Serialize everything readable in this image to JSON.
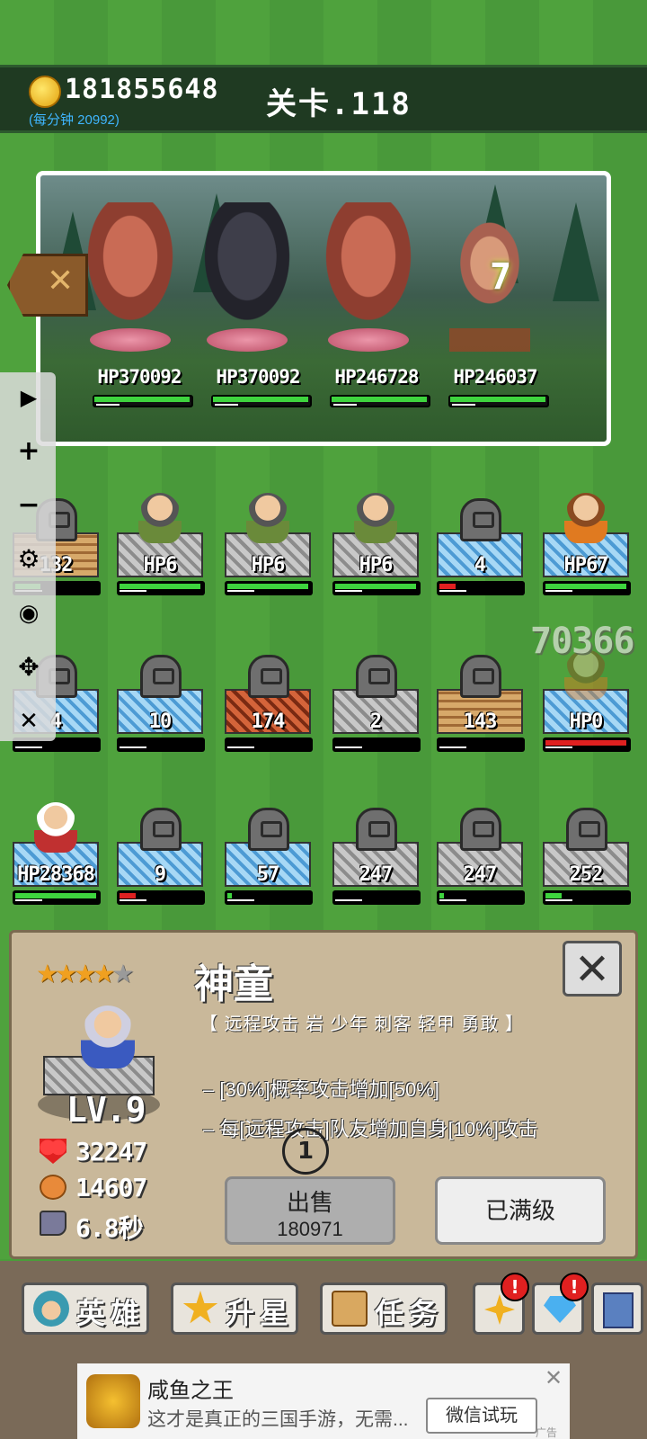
{
  "header": {
    "gold": "181855648",
    "per_minute": "(每分钟 20992)",
    "stage": "关卡.118"
  },
  "battle": {
    "damage_popup": "7",
    "enemies": [
      {
        "type": "ogre",
        "hp": "HP370092",
        "hp_fraction": 0.98
      },
      {
        "type": "dark-knight",
        "hp": "HP370092",
        "hp_fraction": 0.98
      },
      {
        "type": "ogre",
        "hp": "HP246728",
        "hp_fraction": 0.98
      },
      {
        "type": "monk",
        "hp": "HP246037",
        "hp_fraction": 0.98
      }
    ]
  },
  "sidebar": {
    "play": "▶",
    "zoom_in": "+",
    "zoom_out": "−",
    "settings": "⚙",
    "hide": "◉",
    "move": "✥",
    "close": "✕"
  },
  "grid": {
    "floating_number": "70366",
    "cells": [
      {
        "block": "wood",
        "unit": "tomb",
        "label": "132",
        "hp_fraction": 0.3,
        "red": false
      },
      {
        "block": "stone",
        "unit": "boy",
        "label": "HP6",
        "hp_fraction": 0.98,
        "red": false
      },
      {
        "block": "stone",
        "unit": "boy",
        "label": "HP6",
        "hp_fraction": 0.98,
        "red": false
      },
      {
        "block": "stone",
        "unit": "boy",
        "label": "HP6",
        "hp_fraction": 0.98,
        "red": false
      },
      {
        "block": "ice",
        "unit": "tomb",
        "label": "4",
        "hp_fraction": 0.2,
        "red": true
      },
      {
        "block": "ice",
        "unit": "girl",
        "label": "HP67",
        "hp_fraction": 0.98,
        "red": false
      },
      {
        "block": "ice",
        "unit": "tomb",
        "label": "4",
        "hp_fraction": 0,
        "red": false
      },
      {
        "block": "ice",
        "unit": "tomb",
        "label": "10",
        "hp_fraction": 0,
        "red": false
      },
      {
        "block": "lava",
        "unit": "tomb",
        "label": "174",
        "hp_fraction": 0,
        "red": false
      },
      {
        "block": "stone",
        "unit": "tomb",
        "label": "2",
        "hp_fraction": 0,
        "red": false
      },
      {
        "block": "wood",
        "unit": "tomb",
        "label": "143",
        "hp_fraction": 0,
        "red": false
      },
      {
        "block": "ice",
        "unit": "ghost",
        "label": "HP0",
        "hp_fraction": 0.98,
        "red": true
      },
      {
        "block": "ice",
        "unit": "sage",
        "label": "HP28368",
        "hp_fraction": 0.98,
        "red": false
      },
      {
        "block": "ice",
        "unit": "tomb",
        "label": "9",
        "hp_fraction": 0.2,
        "red": true
      },
      {
        "block": "ice",
        "unit": "tomb",
        "label": "57",
        "hp_fraction": 0.05,
        "red": false
      },
      {
        "block": "stone",
        "unit": "tomb",
        "label": "247",
        "hp_fraction": 0,
        "red": false
      },
      {
        "block": "stone",
        "unit": "tomb",
        "label": "247",
        "hp_fraction": 0.05,
        "red": false
      },
      {
        "block": "stone",
        "unit": "tomb",
        "label": "252",
        "hp_fraction": 0.2,
        "red": false
      }
    ]
  },
  "detail": {
    "stars_filled": "★★★★",
    "stars_empty": "★",
    "name": "神童",
    "tags": "【 远程攻击  岩  少年  刺客  轻甲  勇敢 】",
    "close": "✕",
    "level": "LV.9",
    "hp": "32247",
    "attack": "14607",
    "speed": "6.8秒",
    "skills": [
      "– [30%]概率攻击增加[50%]",
      "– 每[远程攻击]队友增加自身[10%]攻击"
    ],
    "target_marker": "1",
    "sell_label": "出售",
    "sell_price": "180971",
    "maxed_label": "已满级"
  },
  "nav": {
    "heroes": "英雄",
    "star_up": "升星",
    "tasks": "任务",
    "alert": "!"
  },
  "ad": {
    "title": "咸鱼之王",
    "desc": "这才是真正的三国手游，无需...",
    "cta": "微信试玩",
    "close": "✕",
    "tag": "广告"
  }
}
